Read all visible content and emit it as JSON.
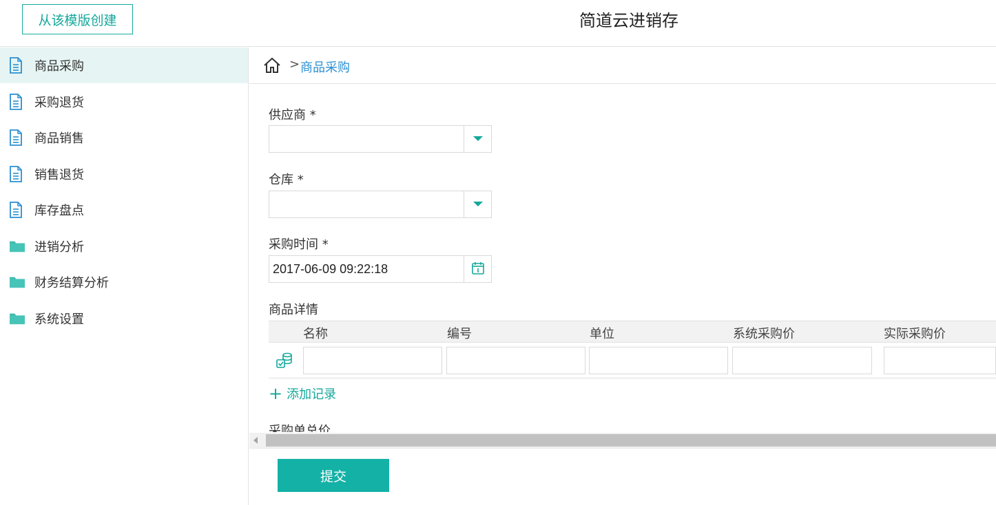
{
  "header": {
    "create_button_label": "从该模版创建",
    "app_title": "简道云进销存"
  },
  "sidebar": {
    "items": [
      {
        "label": "商品采购",
        "icon": "document-icon",
        "active": true
      },
      {
        "label": "采购退货",
        "icon": "document-icon"
      },
      {
        "label": "商品销售",
        "icon": "document-icon"
      },
      {
        "label": "销售退货",
        "icon": "document-icon"
      },
      {
        "label": "库存盘点",
        "icon": "document-icon"
      },
      {
        "label": "进销分析",
        "icon": "folder-icon"
      },
      {
        "label": "财务结算分析",
        "icon": "folder-icon"
      },
      {
        "label": "系统设置",
        "icon": "folder-icon"
      }
    ]
  },
  "breadcrumb": {
    "separator": ">",
    "current": "商品采购"
  },
  "form": {
    "supplier_label": "供应商 *",
    "supplier_value": "",
    "warehouse_label": "仓库 *",
    "warehouse_value": "",
    "purchase_time_label": "采购时间 *",
    "purchase_time_value": "2017-06-09 09:22:18",
    "details_label": "商品详情",
    "columns": [
      "名称",
      "编号",
      "单位",
      "系统采购价",
      "实际采购价"
    ],
    "add_record_label": "添加记录",
    "total_label": "采购单总价",
    "submit_label": "提交"
  },
  "colors": {
    "accent": "#14a89b",
    "link": "#2a8fd2",
    "active_bg": "#e6f5f3"
  }
}
